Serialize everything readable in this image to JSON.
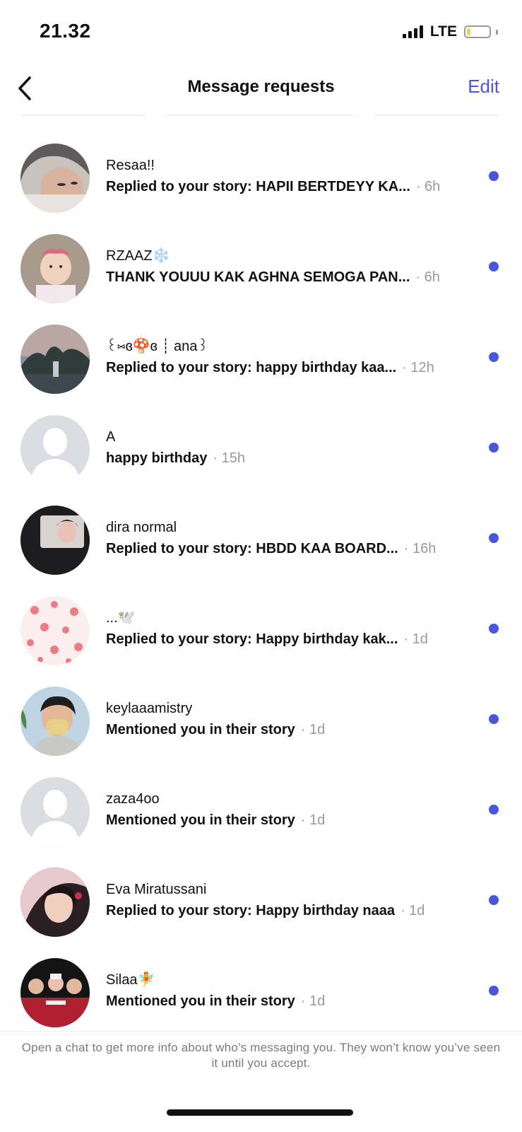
{
  "status": {
    "time": "21.32",
    "network": "LTE"
  },
  "header": {
    "title": "Message requests",
    "edit_label": "Edit"
  },
  "requests": [
    {
      "name": "Resaa!!",
      "snippet": "Replied to your story: HAPII BERTDEYY KA...",
      "time": "· 6h",
      "unread": true
    },
    {
      "name": "RZAAZ❄️",
      "snippet": "THANK YOUUU KAK AGHNA SEMOGA PAN...",
      "time": "· 6h",
      "unread": true
    },
    {
      "name": "꒰⑅ɞ🍄ɞ ┊ ana꒱",
      "snippet": "Replied to your story: happy birthday kaa...",
      "time": "· 12h",
      "unread": true
    },
    {
      "name": "A",
      "snippet": "happy birthday",
      "time": "· 15h",
      "unread": true
    },
    {
      "name": "dira normal",
      "snippet": "Replied to your story: HBDD KAA BOARD...",
      "time": "· 16h",
      "unread": true
    },
    {
      "name": "...🕊️",
      "snippet": "Replied to your story: Happy birthday kak...",
      "time": "· 1d",
      "unread": true
    },
    {
      "name": "keylaaamistry",
      "snippet": "Mentioned you in their story",
      "time": "· 1d",
      "unread": true
    },
    {
      "name": "zaza4oo",
      "snippet": "Mentioned you in their story",
      "time": "· 1d",
      "unread": true
    },
    {
      "name": "Eva Miratussani",
      "snippet": "Replied to your story: Happy birthday naaa",
      "time": "· 1d",
      "unread": true
    },
    {
      "name": "Silaa🧚",
      "snippet": "Mentioned you in their story",
      "time": "· 1d",
      "unread": true
    }
  ],
  "footer": {
    "info": "Open a chat to get more info about who’s messaging you. They won’t know you’ve seen it until you accept."
  },
  "colors": {
    "accent": "#4a55e0",
    "muted": "#9a9a9a",
    "battery": "#f5d14a"
  }
}
